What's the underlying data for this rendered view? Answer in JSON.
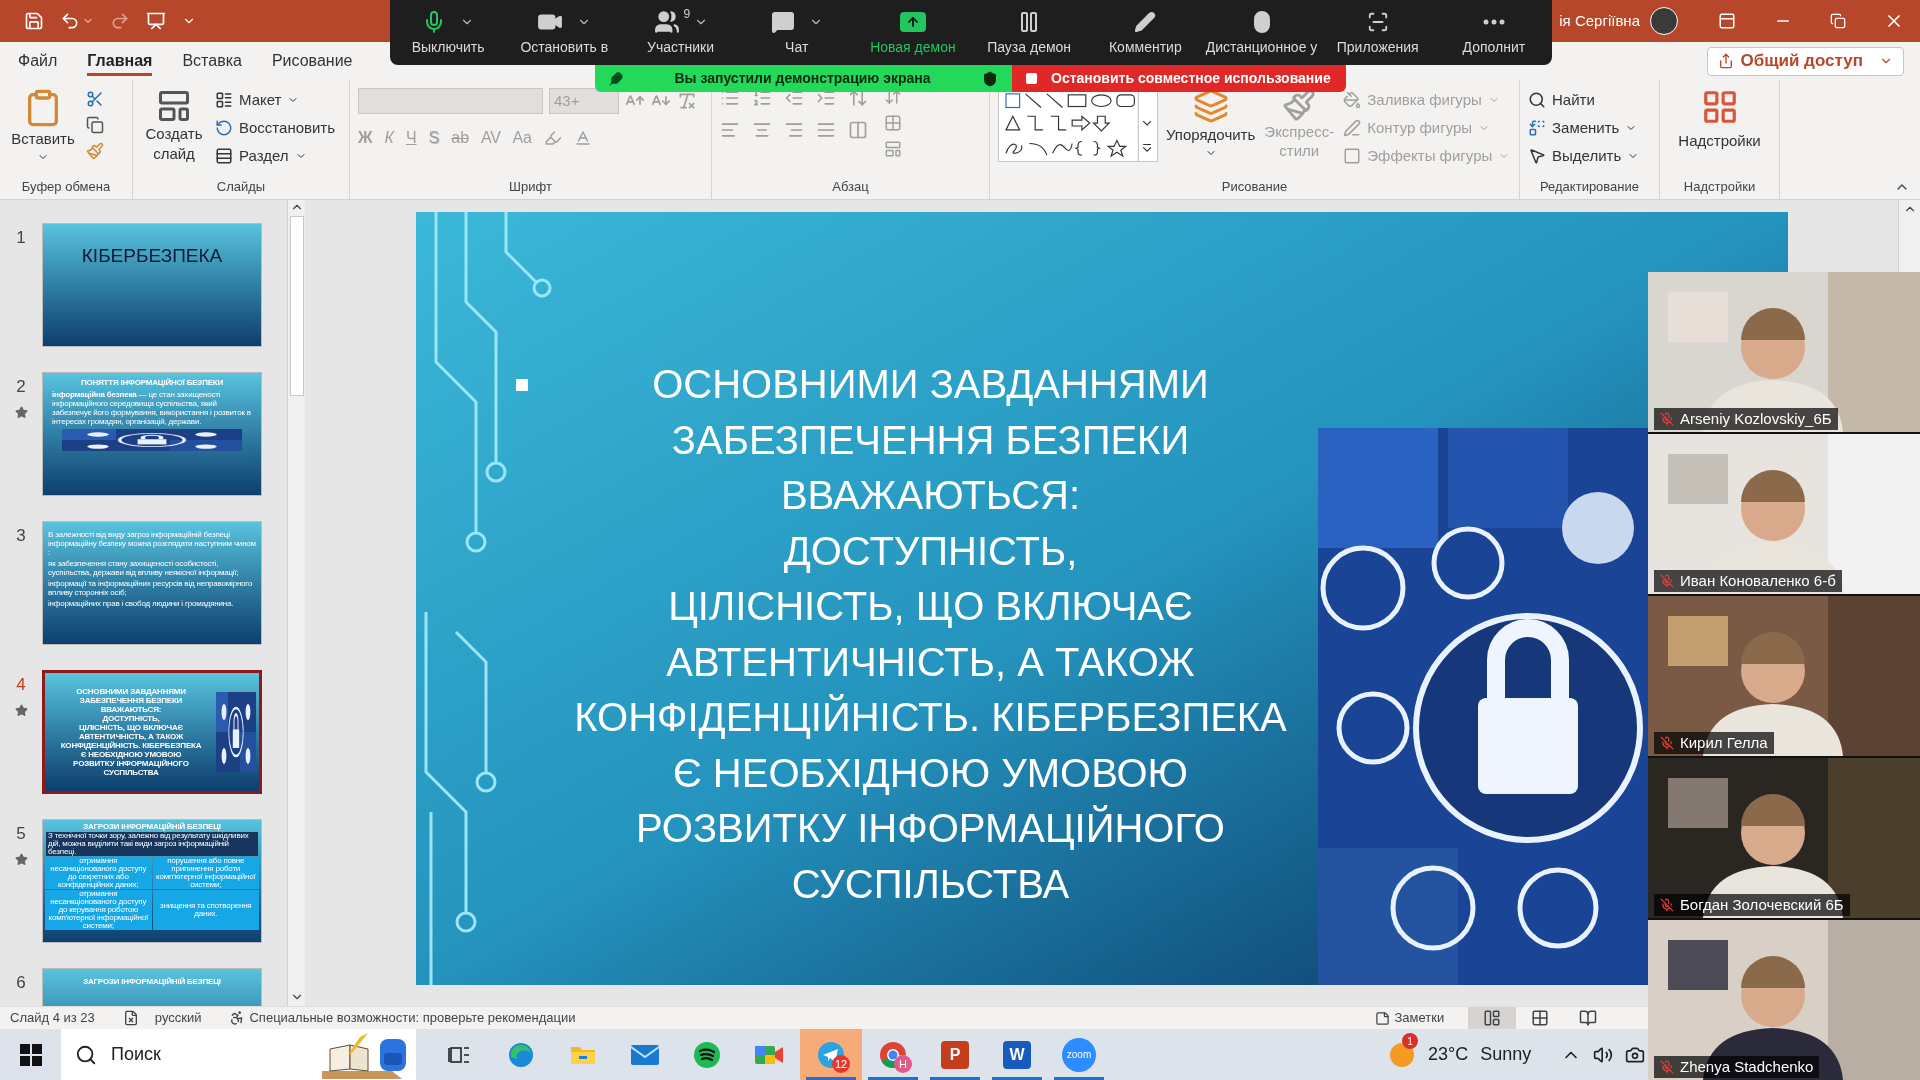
{
  "title_bar": {
    "user": "ія Сергіївна"
  },
  "zoom_toolbar": [
    {
      "label": "Выключить",
      "kind": "mic",
      "has_menu": true
    },
    {
      "label": "Остановить в",
      "kind": "video",
      "has_menu": true
    },
    {
      "label": "Участники",
      "kind": "participants",
      "has_menu": true,
      "count": "9"
    },
    {
      "label": "Чат",
      "kind": "chat",
      "has_menu": true
    },
    {
      "label": "Новая демон",
      "kind": "share",
      "has_menu": false
    },
    {
      "label": "Пауза демон",
      "kind": "pause",
      "has_menu": false
    },
    {
      "label": "Комментир",
      "kind": "annotate",
      "has_menu": false
    },
    {
      "label": "Дистанционное у",
      "kind": "remote",
      "has_menu": false
    },
    {
      "label": "Приложения",
      "kind": "apps",
      "has_menu": false
    },
    {
      "label": "Дополнит",
      "kind": "more",
      "has_menu": false
    }
  ],
  "share_banner": {
    "message": "Вы запустили демонстрацию экрана",
    "stop_button": "Остановить совместное использование"
  },
  "menu_tabs": [
    {
      "label": "Файл",
      "selected": false
    },
    {
      "label": "Главная",
      "selected": true
    },
    {
      "label": "Вставка",
      "selected": false
    },
    {
      "label": "Рисование",
      "selected": false
    }
  ],
  "share_button": "Общий доступ",
  "ribbon": {
    "clipboard": {
      "label": "Буфер обмена",
      "paste": "Вставить"
    },
    "slides": {
      "label": "Слайды",
      "new_slide": "Создать слайд",
      "items": [
        "Макет",
        "Восстановить",
        "Раздел"
      ]
    },
    "font": {
      "label": "Шрифт",
      "disabled": true,
      "size": "43+",
      "buttons": [
        "Ж",
        "К",
        "Ч",
        "S",
        "ab",
        "AV",
        "Aa"
      ]
    },
    "paragraph": {
      "label": "Абзац"
    },
    "drawing": {
      "label": "Рисование",
      "arrange": "Упорядочить",
      "quick_styles": {
        "label": "Экспресс-стили",
        "disabled": true
      },
      "shape_options": [
        {
          "label": "Заливка фигуры",
          "disabled": true
        },
        {
          "label": "Контур фигуры",
          "disabled": true
        },
        {
          "label": "Эффекты фигуры",
          "disabled": true
        }
      ]
    },
    "editing": {
      "label": "Редактирование",
      "items": [
        "Найти",
        "Заменить",
        "Выделить"
      ]
    },
    "addins": {
      "label": "Надстройки",
      "button": "Надстройки"
    }
  },
  "thumbnails": [
    {
      "number": "1",
      "starred": false,
      "selected": false,
      "kind": "title",
      "title": "КІБЕРБЕЗПЕКА"
    },
    {
      "number": "2",
      "starred": true,
      "selected": false,
      "kind": "text_picture",
      "title": "ПОНЯТТЯ ІНФОРМАЦІЙНОЇ БЕЗПЕКИ",
      "bullets": [
        "**інформаційна безпека** — це стан захищеності інформаційного середовища суспільства, який забезпечує його формування, використання і розвиток в інтересах громадян, організацій, держави."
      ]
    },
    {
      "number": "3",
      "starred": false,
      "selected": false,
      "kind": "text",
      "intro": "В залежності від виду загроз інформаційній безпеці інформаційну безпеку можна розглядати наступним чином :",
      "bullets": [
        "як забезпечення стану захищеності особистості, суспільства, держави від впливу неякісної інформації;",
        "інформації та інформаційних ресурсів від неправомірного впливу сторонніх осіб;",
        "інформаційних прав і свобод людини і громадянина."
      ]
    },
    {
      "number": "4",
      "starred": true,
      "selected": true,
      "kind": "side_picture",
      "lines": [
        "ОСНОВНИМИ ЗАВДАННЯМИ",
        "ЗАБЕЗПЕЧЕННЯ БЕЗПЕКИ",
        "ВВАЖАЮТЬСЯ:",
        "ДОСТУПНІСТЬ,",
        "ЦІЛІСНІСТЬ, ЩО ВКЛЮЧАЄ",
        "АВТЕНТИЧНІСТЬ, А ТАКОЖ",
        "КОНФІДЕНЦІЙНІСТЬ. КІБЕРБЕЗПЕКА",
        "Є НЕОБХІДНОЮ УМОВОЮ",
        "РОЗВИТКУ ІНФОРМАЦІЙНОГО",
        "СУСПІЛЬСТВА"
      ]
    },
    {
      "number": "5",
      "starred": true,
      "selected": false,
      "kind": "table",
      "title": "ЗАГРОЗИ ІНФОРМАЦІЙНІЙ БЕЗПЕЦІ",
      "intro": "З технічної точки зору, залежно від результату шкідливих дій, можна виділити такі види загроз інформаційній безпеці.",
      "cells": [
        "отримання несанкціонованого доступу до секретних або конфіденційних даних;",
        "порушення або повне припинення роботи комп'ютерної інформаційної системи;",
        "отримання несанкціонованого доступу до керування роботою комп'ютерної інформаційної системи;",
        "знищення та спотворення даних."
      ]
    },
    {
      "number": "6",
      "starred": false,
      "selected": false,
      "kind": "title_top",
      "title": "ЗАГРОЗИ ІНФОРМАЦІЙНІЙ БЕЗПЕЦІ"
    }
  ],
  "slide": {
    "lines": [
      "ОСНОВНИМИ ЗАВДАННЯМИ",
      "ЗАБЕЗПЕЧЕННЯ БЕЗПЕКИ",
      "ВВАЖАЮТЬСЯ:",
      "ДОСТУПНІСТЬ,",
      "ЦІЛІСНІСТЬ, ЩО ВКЛЮЧАЄ",
      "АВТЕНТИЧНІСТЬ, А ТАКОЖ",
      "КОНФІДЕНЦІЙНІСТЬ. КІБЕРБЕЗПЕКА",
      "Є НЕОБХІДНОЮ УМОВОЮ",
      "РОЗВИТКУ ІНФОРМАЦІЙНОГО",
      "СУСПІЛЬСТВА"
    ]
  },
  "video_tiles": [
    {
      "name": "Arseniy Kozlovskiy_6Б",
      "muted": true
    },
    {
      "name": "Иван Коноваленко 6-б",
      "muted": true
    },
    {
      "name": "Кирил Гелла",
      "muted": true
    },
    {
      "name": "Богдан Золочевский 6Б",
      "muted": true
    },
    {
      "name": "Zhenya Stadchenko",
      "muted": true
    }
  ],
  "status_bar": {
    "slide": "Слайд 4 из 23",
    "language": "русский",
    "accessibility": "Специальные возможности: проверьте рекомендации",
    "notes": "Заметки",
    "views": [
      {
        "kind": "normal",
        "selected": true
      },
      {
        "kind": "sorter",
        "selected": false
      },
      {
        "kind": "reading",
        "selected": false
      }
    ]
  },
  "taskbar": {
    "search": "Поиск",
    "apps": [
      {
        "kind": "taskview",
        "running": false,
        "selected": false
      },
      {
        "kind": "edge",
        "running": false,
        "selected": false
      },
      {
        "kind": "explorer",
        "running": false,
        "selected": false
      },
      {
        "kind": "mail",
        "running": false,
        "selected": false
      },
      {
        "kind": "spotify",
        "running": false,
        "selected": false
      },
      {
        "kind": "meet",
        "running": false,
        "selected": false
      },
      {
        "kind": "telegram",
        "running": true,
        "selected": true,
        "badge": "12"
      },
      {
        "kind": "chrome",
        "running": true,
        "selected": false,
        "badge": "H"
      },
      {
        "kind": "powerpoint",
        "running": true,
        "selected": false,
        "label": "P"
      },
      {
        "kind": "word",
        "running": true,
        "selected": false,
        "label": "W"
      },
      {
        "kind": "zoom",
        "running": true,
        "selected": false,
        "label": "zoom"
      }
    ],
    "weather": {
      "badge": "1",
      "temperature": "23°C",
      "condition": "Sunny"
    }
  }
}
